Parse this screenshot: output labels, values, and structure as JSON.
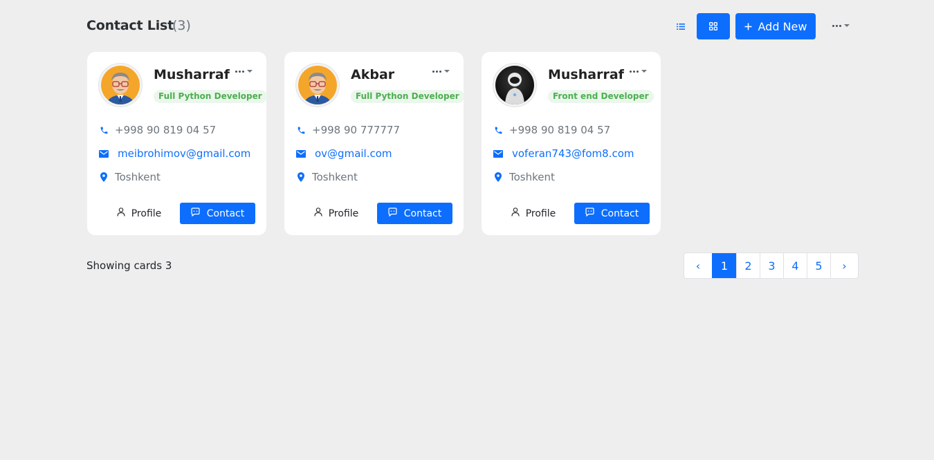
{
  "header": {
    "title": "Contact List",
    "count": "(3)",
    "add_new_label": "Add New",
    "accent_color": "#0d6efd"
  },
  "contacts": [
    {
      "name": "Musharraf",
      "role": "Full Python Developer",
      "phone": "+998 90 819 04 57",
      "email": "meibrohimov@gmail.com",
      "location": "Toshkent",
      "avatar": "cartoon-man-glasses-avatar",
      "profile_label": "Profile",
      "contact_label": "Contact"
    },
    {
      "name": "Akbar",
      "role": "Full Python Developer",
      "phone": "+998 90 777777",
      "email": "ov@gmail.com",
      "location": "Toshkent",
      "avatar": "cartoon-man-glasses-avatar",
      "profile_label": "Profile",
      "contact_label": "Contact"
    },
    {
      "name": "Musharraf",
      "role": "Front end Developer",
      "phone": "+998 90 819 04 57",
      "email": "voferan743@fom8.com",
      "location": "Toshkent",
      "avatar": "robot-avatar",
      "profile_label": "Profile",
      "contact_label": "Contact"
    }
  ],
  "footer": {
    "showing_text": "Showing cards 3",
    "pagination": {
      "prev": "‹",
      "pages": [
        "1",
        "2",
        "3",
        "4",
        "5"
      ],
      "active_page": "1",
      "next": "›"
    }
  }
}
